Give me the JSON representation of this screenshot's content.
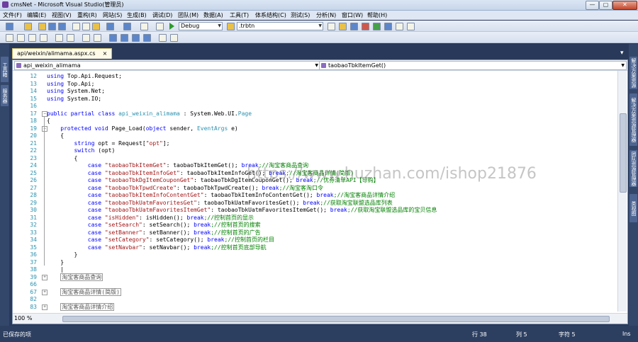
{
  "window": {
    "title": "cmsNet - Microsoft Visual Studio(管理员)",
    "min": "—",
    "max": "▢",
    "close": "✕"
  },
  "menu": [
    "文件(F)",
    "编辑(E)",
    "视图(V)",
    "重构(R)",
    "网站(S)",
    "生成(B)",
    "调试(D)",
    "团队(M)",
    "数据(A)",
    "工具(T)",
    "体系结构(C)",
    "测试(S)",
    "分析(N)",
    "窗口(W)",
    "帮助(H)"
  ],
  "toolbar": {
    "config": "Debug",
    "find": ".trbtn"
  },
  "left_tools": {
    "toolbox": "工具箱",
    "server": "服务器"
  },
  "right_tools": [
    "解决方案资源管理器",
    "解决方案资源管理器",
    "团队资源管理器",
    "类视图"
  ],
  "tab": {
    "label": "api/weixin/alimama.aspx.cs",
    "close": "×"
  },
  "nav": {
    "class_box": "api_weixin_alimama",
    "member_box": "taobaoTbkItemGet()"
  },
  "editor": {
    "zoom": "100 %"
  },
  "watermark": "https://www.huzhan.com/ishop21876",
  "lines": [
    {
      "n": "12",
      "seg": [
        {
          "c": "kw",
          "t": "using "
        },
        {
          "c": "",
          "t": "Top.Api.Request;"
        }
      ]
    },
    {
      "n": "13",
      "seg": [
        {
          "c": "kw",
          "t": "using "
        },
        {
          "c": "",
          "t": "Top.Api;"
        }
      ]
    },
    {
      "n": "14",
      "seg": [
        {
          "c": "kw",
          "t": "using "
        },
        {
          "c": "",
          "t": "System.Net;"
        }
      ]
    },
    {
      "n": "15",
      "seg": [
        {
          "c": "kw",
          "t": "using "
        },
        {
          "c": "",
          "t": "System.IO;"
        }
      ]
    },
    {
      "n": "16",
      "seg": []
    },
    {
      "n": "17",
      "fold": "−",
      "seg": [
        {
          "c": "kw",
          "t": "public partial class "
        },
        {
          "c": "ty",
          "t": "api_weixin_alimama"
        },
        {
          "c": "",
          "t": " : System.Web.UI."
        },
        {
          "c": "ty",
          "t": "Page"
        }
      ]
    },
    {
      "n": "18",
      "seg": [
        {
          "c": "",
          "t": "{"
        }
      ]
    },
    {
      "n": "19",
      "fold": "−",
      "seg": [
        {
          "c": "",
          "t": "    "
        },
        {
          "c": "kw",
          "t": "protected void "
        },
        {
          "c": "",
          "t": "Page_Load("
        },
        {
          "c": "kw",
          "t": "object "
        },
        {
          "c": "",
          "t": "sender, "
        },
        {
          "c": "ty",
          "t": "EventArgs"
        },
        {
          "c": "",
          "t": " e)"
        }
      ]
    },
    {
      "n": "20",
      "seg": [
        {
          "c": "",
          "t": "    {"
        }
      ]
    },
    {
      "n": "21",
      "seg": [
        {
          "c": "",
          "t": "        "
        },
        {
          "c": "kw",
          "t": "string "
        },
        {
          "c": "",
          "t": "opt = Request["
        },
        {
          "c": "str",
          "t": "\"opt\""
        },
        {
          "c": "",
          "t": "];"
        }
      ]
    },
    {
      "n": "22",
      "seg": [
        {
          "c": "",
          "t": "        "
        },
        {
          "c": "kw",
          "t": "switch "
        },
        {
          "c": "",
          "t": "(opt)"
        }
      ]
    },
    {
      "n": "23",
      "seg": [
        {
          "c": "",
          "t": "        {"
        }
      ]
    },
    {
      "n": "24",
      "seg": [
        {
          "c": "",
          "t": "            "
        },
        {
          "c": "kw",
          "t": "case "
        },
        {
          "c": "str",
          "t": "\"taobaoTbkItemGet\""
        },
        {
          "c": "",
          "t": ": taobaoTbkItemGet(); "
        },
        {
          "c": "kw",
          "t": "break"
        },
        {
          "c": "cm",
          "t": ";//淘宝客商品查询"
        }
      ]
    },
    {
      "n": "25",
      "seg": [
        {
          "c": "",
          "t": "            "
        },
        {
          "c": "kw",
          "t": "case "
        },
        {
          "c": "str",
          "t": "\"taobaoTbkItemInfoGet\""
        },
        {
          "c": "",
          "t": ": taobaoTbkItemInfoGet(); "
        },
        {
          "c": "kw",
          "t": "break"
        },
        {
          "c": "cm",
          "t": ";//淘宝客商品详情(简版)"
        }
      ]
    },
    {
      "n": "26",
      "seg": [
        {
          "c": "",
          "t": "            "
        },
        {
          "c": "kw",
          "t": "case "
        },
        {
          "c": "str",
          "t": "\"taobaoTbkDgItemCouponGet\""
        },
        {
          "c": "",
          "t": ": taobaoTbkDgItemCouponGet(); "
        },
        {
          "c": "kw",
          "t": "break"
        },
        {
          "c": "cm",
          "t": ";//优券清单API【导购】"
        }
      ]
    },
    {
      "n": "27",
      "seg": [
        {
          "c": "",
          "t": "            "
        },
        {
          "c": "kw",
          "t": "case "
        },
        {
          "c": "str",
          "t": "\"taobaoTbkTpwdCreate\""
        },
        {
          "c": "",
          "t": ": taobaoTbkTpwdCreate(); "
        },
        {
          "c": "kw",
          "t": "break"
        },
        {
          "c": "cm",
          "t": ";//淘宝客淘口令"
        }
      ]
    },
    {
      "n": "28",
      "seg": [
        {
          "c": "",
          "t": "            "
        },
        {
          "c": "kw",
          "t": "case "
        },
        {
          "c": "str",
          "t": "\"taobaoTbkItemInfoContentGet\""
        },
        {
          "c": "",
          "t": ": taobaoTbkItemInfoContentGet(); "
        },
        {
          "c": "kw",
          "t": "break"
        },
        {
          "c": "cm",
          "t": ";//淘宝客商品详情介绍"
        }
      ]
    },
    {
      "n": "29",
      "seg": [
        {
          "c": "",
          "t": "            "
        },
        {
          "c": "kw",
          "t": "case "
        },
        {
          "c": "str",
          "t": "\"taobaoTbkUatmFavoritesGet\""
        },
        {
          "c": "",
          "t": ": taobaoTbkUatmFavoritesGet(); "
        },
        {
          "c": "kw",
          "t": "break"
        },
        {
          "c": "cm",
          "t": ";//获取淘宝联盟选品库列表"
        }
      ]
    },
    {
      "n": "30",
      "seg": [
        {
          "c": "",
          "t": "            "
        },
        {
          "c": "kw",
          "t": "case "
        },
        {
          "c": "str",
          "t": "\"taobaoTbkUatmFavoritesItemGet\""
        },
        {
          "c": "",
          "t": ": taobaoTbkUatmFavoritesItemGet(); "
        },
        {
          "c": "kw",
          "t": "break"
        },
        {
          "c": "cm",
          "t": ";//获取淘宝联盟选品库的宝贝信息"
        }
      ]
    },
    {
      "n": "31",
      "seg": [
        {
          "c": "",
          "t": "            "
        },
        {
          "c": "kw",
          "t": "case "
        },
        {
          "c": "str",
          "t": "\"isHidden\""
        },
        {
          "c": "",
          "t": ": isHidden(); "
        },
        {
          "c": "kw",
          "t": "break"
        },
        {
          "c": "cm",
          "t": ";//控制首页的显示"
        }
      ]
    },
    {
      "n": "32",
      "seg": [
        {
          "c": "",
          "t": "            "
        },
        {
          "c": "kw",
          "t": "case "
        },
        {
          "c": "str",
          "t": "\"setSearch\""
        },
        {
          "c": "",
          "t": ": setSearch(); "
        },
        {
          "c": "kw",
          "t": "break"
        },
        {
          "c": "cm",
          "t": ";//控制首页的搜索"
        }
      ]
    },
    {
      "n": "33",
      "seg": [
        {
          "c": "",
          "t": "            "
        },
        {
          "c": "kw",
          "t": "case "
        },
        {
          "c": "str",
          "t": "\"setBanner\""
        },
        {
          "c": "",
          "t": ": setBanner(); "
        },
        {
          "c": "kw",
          "t": "break"
        },
        {
          "c": "cm",
          "t": ";//控制首页的广告"
        }
      ]
    },
    {
      "n": "34",
      "seg": [
        {
          "c": "",
          "t": "            "
        },
        {
          "c": "kw",
          "t": "case "
        },
        {
          "c": "str",
          "t": "\"setCategory\""
        },
        {
          "c": "",
          "t": ": setCategory(); "
        },
        {
          "c": "kw",
          "t": "break"
        },
        {
          "c": "cm",
          "t": ";//控制首页的栏目"
        }
      ]
    },
    {
      "n": "35",
      "seg": [
        {
          "c": "",
          "t": "            "
        },
        {
          "c": "kw",
          "t": "case "
        },
        {
          "c": "str",
          "t": "\"setNavbar\""
        },
        {
          "c": "",
          "t": ": setNavbar(); "
        },
        {
          "c": "kw",
          "t": "break"
        },
        {
          "c": "cm",
          "t": ";//控制首页底部导航"
        }
      ]
    },
    {
      "n": "36",
      "seg": [
        {
          "c": "",
          "t": "        }"
        }
      ]
    },
    {
      "n": "37",
      "seg": [
        {
          "c": "",
          "t": "    }"
        }
      ]
    },
    {
      "n": "38",
      "seg": [
        {
          "c": "",
          "t": "    |"
        }
      ]
    },
    {
      "n": "39",
      "fold": "+",
      "seg": [
        {
          "c": "",
          "t": "    "
        },
        {
          "c": "collapsed",
          "t": "淘宝客商品查询"
        }
      ]
    },
    {
      "n": "66",
      "seg": []
    },
    {
      "n": "67",
      "fold": "+",
      "seg": [
        {
          "c": "",
          "t": "    "
        },
        {
          "c": "collapsed",
          "t": "淘宝客商品详情(简版)"
        }
      ]
    },
    {
      "n": "82",
      "seg": []
    },
    {
      "n": "83",
      "fold": "+",
      "seg": [
        {
          "c": "",
          "t": "    "
        },
        {
          "c": "collapsed",
          "t": "淘宝客商品详情介绍"
        }
      ]
    }
  ],
  "status": {
    "left": "已保存的项",
    "row": "行 38",
    "col": "列 5",
    "ch": "字符 5",
    "mode": "Ins"
  }
}
